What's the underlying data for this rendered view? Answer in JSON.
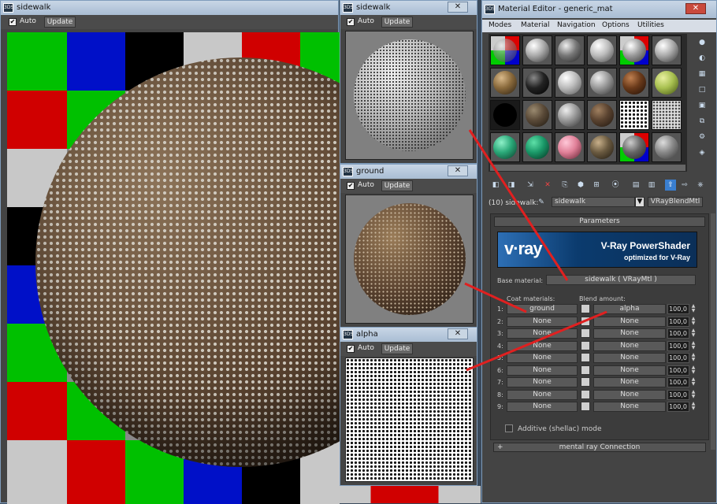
{
  "sidewalk_window": {
    "title": "sidewalk",
    "auto_label": "Auto",
    "update_label": "Update",
    "auto_checked": true
  },
  "preview_sidewalk": {
    "title": "sidewalk",
    "auto_label": "Auto",
    "update_label": "Update",
    "close": "✕"
  },
  "preview_ground": {
    "title": "ground",
    "auto_label": "Auto",
    "update_label": "Update",
    "close": "✕"
  },
  "preview_alpha": {
    "title": "alpha",
    "auto_label": "Auto",
    "update_label": "Update",
    "close": "✕"
  },
  "material_editor": {
    "title": "Material Editor - generic_mat",
    "close": "✕",
    "menu": [
      "Modes",
      "Material",
      "Navigation",
      "Options",
      "Utilities"
    ],
    "material_name_prefix": "(10) sidewalk:",
    "material_name_value": "sidewalk",
    "material_type": "VRayBlendMtl",
    "parameters_title": "Parameters",
    "vray_logo_text": "v·ray",
    "banner_title": "V-Ray PowerShader",
    "banner_subtitle": "optimized for V-Ray",
    "base_material_label": "Base material:",
    "base_material_value": "sidewalk  ( VRayMtl )",
    "coat_header": "Coat materials:",
    "blend_header": "Blend amount:",
    "rows": [
      {
        "index": "1:",
        "coat": "ground",
        "blend": "alpha",
        "amount": "100,0"
      },
      {
        "index": "2:",
        "coat": "None",
        "blend": "None",
        "amount": "100,0"
      },
      {
        "index": "3:",
        "coat": "None",
        "blend": "None",
        "amount": "100,0"
      },
      {
        "index": "4:",
        "coat": "None",
        "blend": "None",
        "amount": "100,0"
      },
      {
        "index": "5:",
        "coat": "None",
        "blend": "None",
        "amount": "100,0"
      },
      {
        "index": "6:",
        "coat": "None",
        "blend": "None",
        "amount": "100,0"
      },
      {
        "index": "7:",
        "coat": "None",
        "blend": "None",
        "amount": "100,0"
      },
      {
        "index": "8:",
        "coat": "None",
        "blend": "None",
        "amount": "100,0"
      },
      {
        "index": "9:",
        "coat": "None",
        "blend": "None",
        "amount": "100,0"
      }
    ],
    "additive_label": "Additive (shellac) mode",
    "mental_ray_label": "mental ray Connection",
    "mental_ray_toggle": "+"
  },
  "colors": {
    "title_bar": "#b9cadd",
    "panel": "#444444",
    "arrow_red": "#e02020",
    "vray_blue": "#0b3b6e"
  }
}
